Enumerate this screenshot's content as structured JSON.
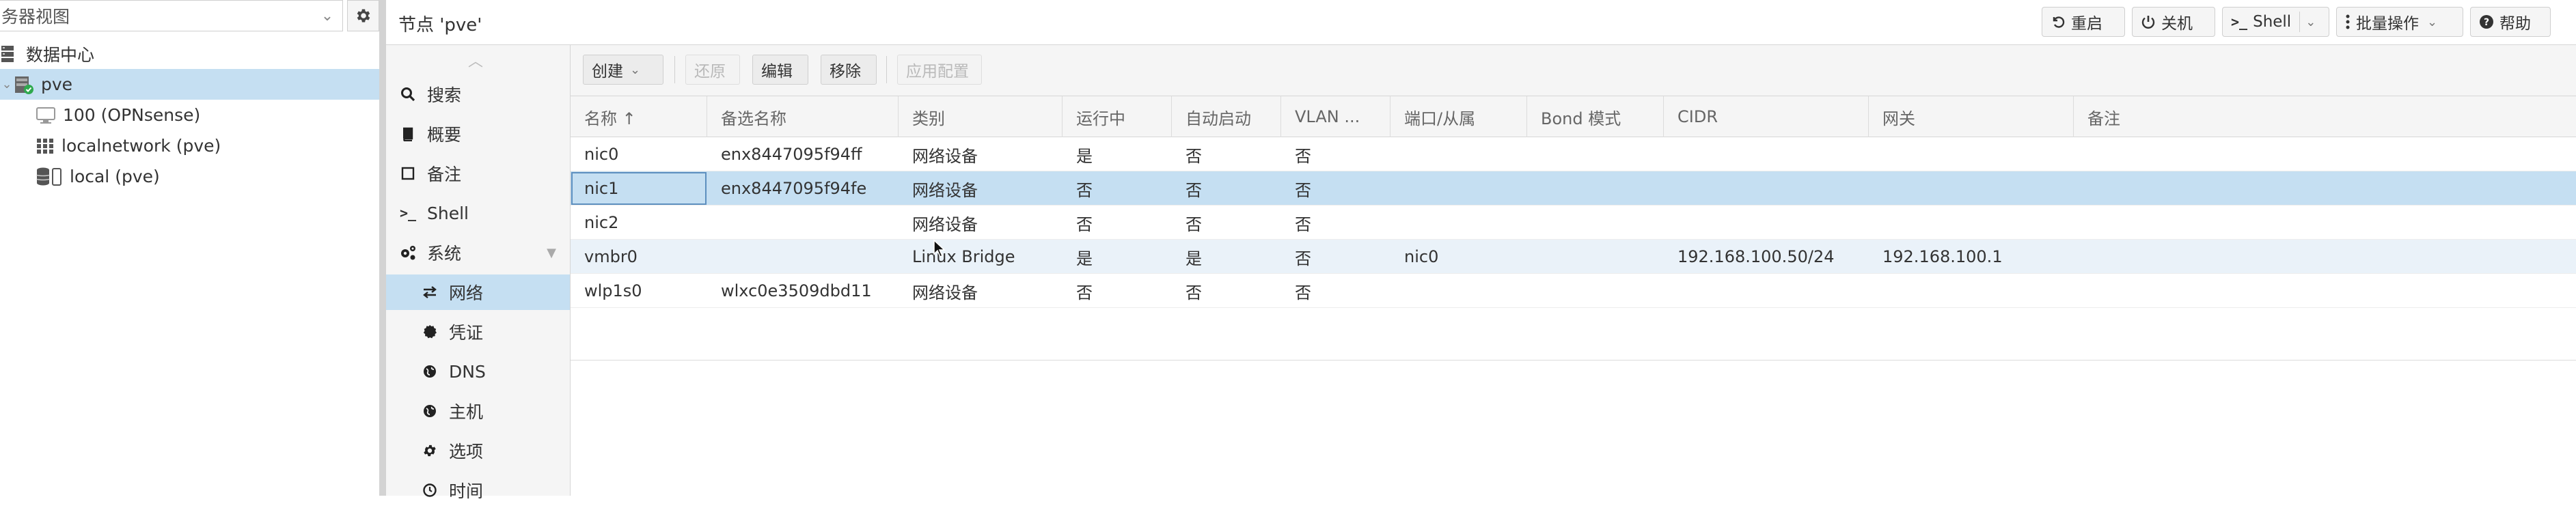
{
  "resource_tree": {
    "view_label": "务器视图",
    "items": [
      {
        "label": "数据中心",
        "icon": "server-stack-icon"
      },
      {
        "label": "pve",
        "icon": "node-online-icon"
      },
      {
        "label": "100 (OPNsense)",
        "icon": "vm-monitor-icon"
      },
      {
        "label": "localnetwork (pve)",
        "icon": "sdn-grid-icon"
      },
      {
        "label": "local (pve)",
        "icon": "storage-db-icon"
      }
    ]
  },
  "header": {
    "title": "节点 'pve'",
    "buttons": {
      "reboot": "重启",
      "shutdown": "关机",
      "shell": "Shell",
      "bulk": "批量操作",
      "help": "帮助"
    }
  },
  "nav": {
    "items": [
      {
        "label": "搜索",
        "icon": "search-icon"
      },
      {
        "label": "概要",
        "icon": "book-icon"
      },
      {
        "label": "备注",
        "icon": "note-icon"
      },
      {
        "label": "Shell",
        "icon": "terminal-icon"
      },
      {
        "label": "系统",
        "icon": "cogs-icon"
      },
      {
        "label": "网络",
        "icon": "exchange-icon"
      },
      {
        "label": "凭证",
        "icon": "certificate-icon"
      },
      {
        "label": "DNS",
        "icon": "globe-icon"
      },
      {
        "label": "主机",
        "icon": "globe-icon"
      },
      {
        "label": "选项",
        "icon": "gear-icon"
      },
      {
        "label": "时间",
        "icon": "clock-icon"
      }
    ]
  },
  "toolbar": {
    "create": "创建",
    "revert": "还原",
    "edit": "编辑",
    "remove": "移除",
    "apply": "应用配置"
  },
  "grid": {
    "columns": {
      "name": "名称 ↑",
      "alt": "备选名称",
      "type": "类别",
      "active": "运行中",
      "autostart": "自动启动",
      "vlan": "VLAN ...",
      "ports": "端口/从属",
      "bond": "Bond 模式",
      "cidr": "CIDR",
      "gateway": "网关",
      "comment": "备注"
    },
    "rows": [
      {
        "name": "nic0",
        "alt": "enx8447095f94ff",
        "type": "网络设备",
        "active": "是",
        "autostart": "否",
        "vlan": "否",
        "ports": "",
        "bond": "",
        "cidr": "",
        "gateway": "",
        "comment": ""
      },
      {
        "name": "nic1",
        "alt": "enx8447095f94fe",
        "type": "网络设备",
        "active": "否",
        "autostart": "否",
        "vlan": "否",
        "ports": "",
        "bond": "",
        "cidr": "",
        "gateway": "",
        "comment": ""
      },
      {
        "name": "nic2",
        "alt": "",
        "type": "网络设备",
        "active": "否",
        "autostart": "否",
        "vlan": "否",
        "ports": "",
        "bond": "",
        "cidr": "",
        "gateway": "",
        "comment": ""
      },
      {
        "name": "vmbr0",
        "alt": "",
        "type": "Linux Bridge",
        "active": "是",
        "autostart": "是",
        "vlan": "否",
        "ports": "nic0",
        "bond": "",
        "cidr": "192.168.100.50/24",
        "gateway": "192.168.100.1",
        "comment": ""
      },
      {
        "name": "wlp1s0",
        "alt": "wlxc0e3509dbd11",
        "type": "网络设备",
        "active": "否",
        "autostart": "否",
        "vlan": "否",
        "ports": "",
        "bond": "",
        "cidr": "",
        "gateway": "",
        "comment": ""
      }
    ]
  },
  "colors": {
    "selection": "#c5dff2",
    "hover": "#eaf2f9",
    "panel_bg": "#f5f5f5",
    "online_badge": "#2fa94e"
  }
}
